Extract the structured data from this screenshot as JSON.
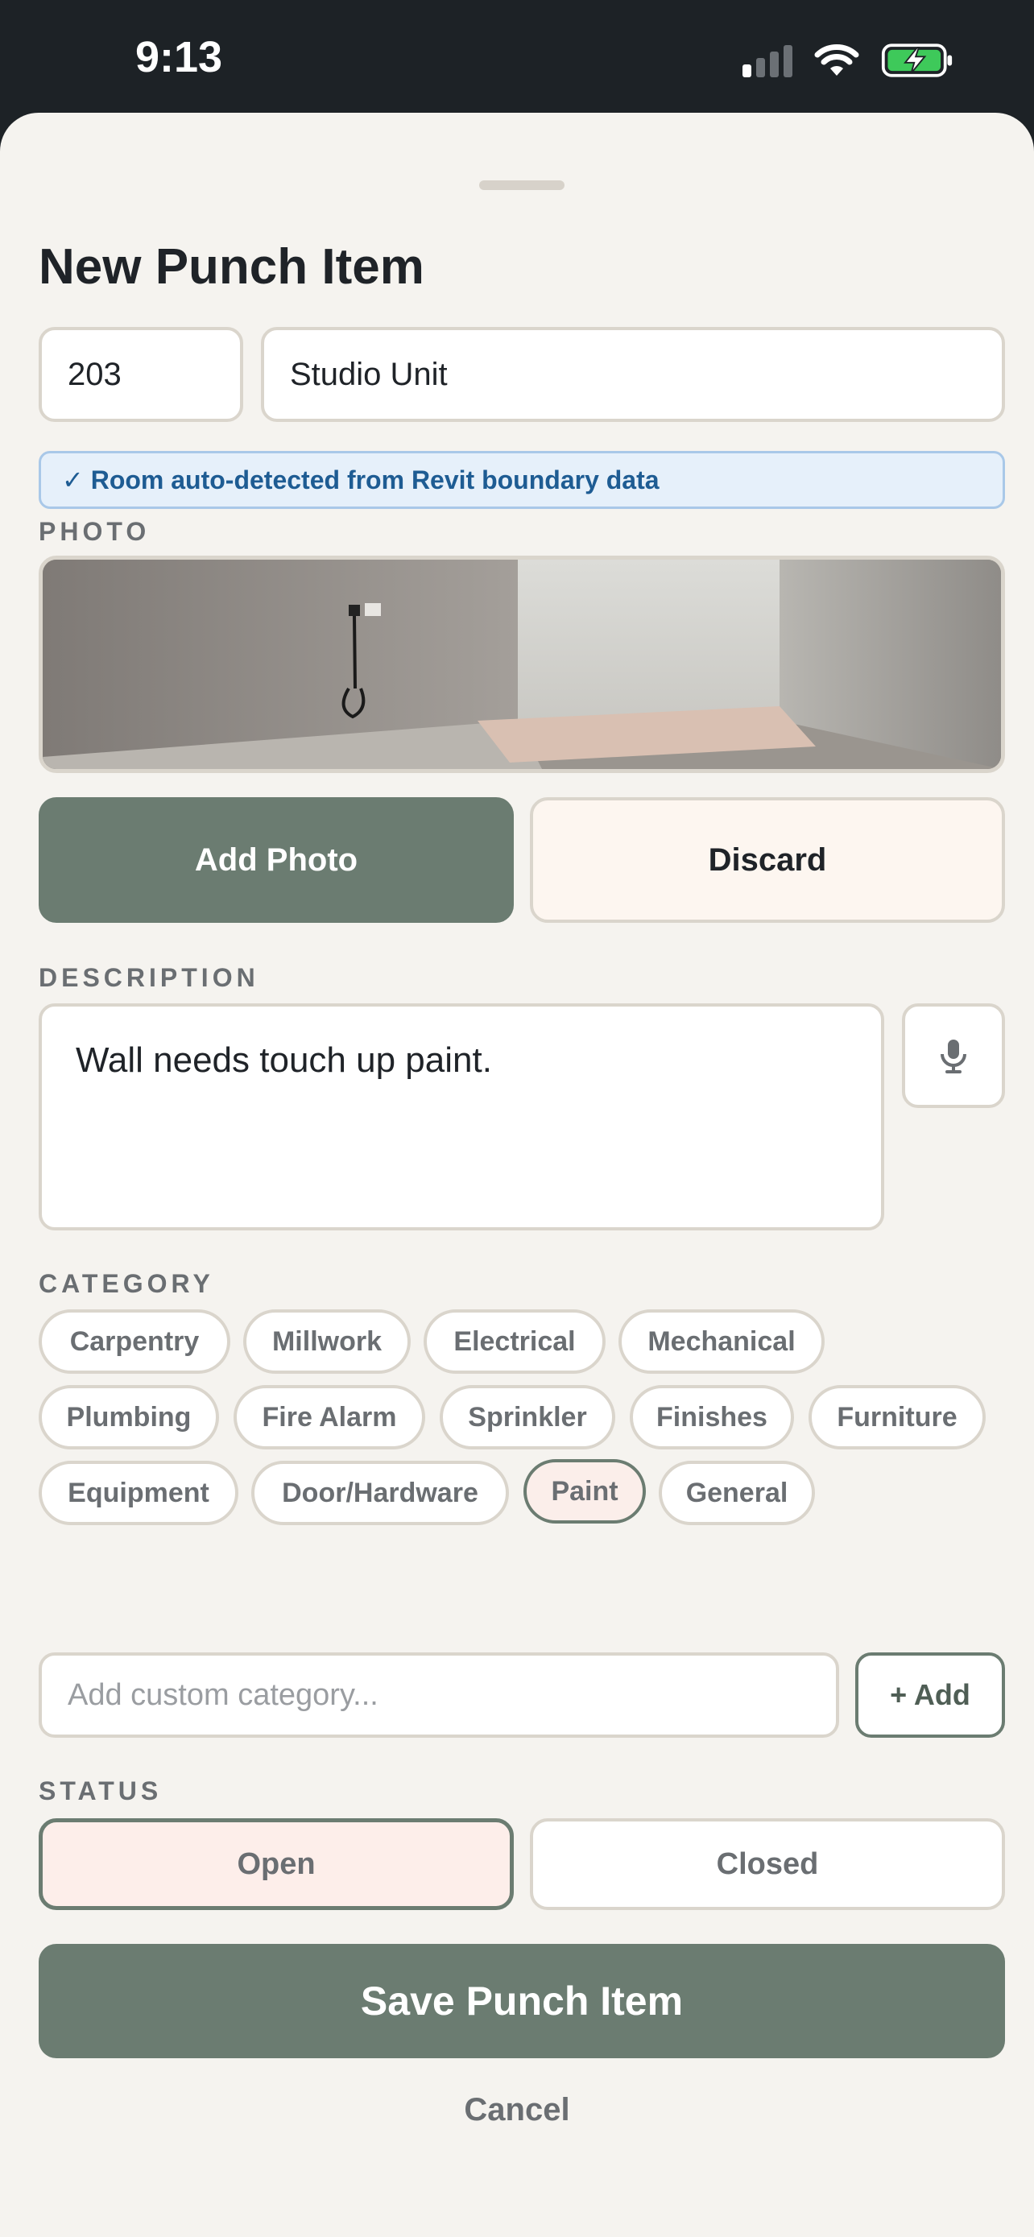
{
  "status_bar": {
    "time": "9:13",
    "signal_bars_on": 1,
    "signal_bars_total": 4,
    "battery_color": "#3ec95a"
  },
  "sheet": {
    "title": "New Punch Item",
    "room_number": "203",
    "room_name": "Studio Unit",
    "detect_banner": "✓ Room auto-detected from Revit boundary data"
  },
  "photo": {
    "label": "PHOTO",
    "add_label": "Add Photo",
    "discard_label": "Discard"
  },
  "description": {
    "label": "DESCRIPTION",
    "value": "Wall needs touch up paint."
  },
  "category": {
    "label": "CATEGORY",
    "options": [
      "Carpentry",
      "Millwork",
      "Electrical",
      "Mechanical",
      "Plumbing",
      "Fire Alarm",
      "Sprinkler",
      "Finishes",
      "Furniture",
      "Equipment",
      "Door/Hardware",
      "Paint",
      "General"
    ],
    "selected": "Paint",
    "custom_placeholder": "Add custom category...",
    "add_custom_label": "+ Add"
  },
  "status": {
    "label": "STATUS",
    "open_label": "Open",
    "closed_label": "Closed",
    "selected": "Open"
  },
  "actions": {
    "save_label": "Save Punch Item",
    "cancel_label": "Cancel"
  },
  "colors": {
    "accent": "#6b7c71",
    "sheet_background": "#f5f3ef",
    "banner_text": "#1e5c93",
    "selected_chip_bg": "#fbeeea"
  }
}
